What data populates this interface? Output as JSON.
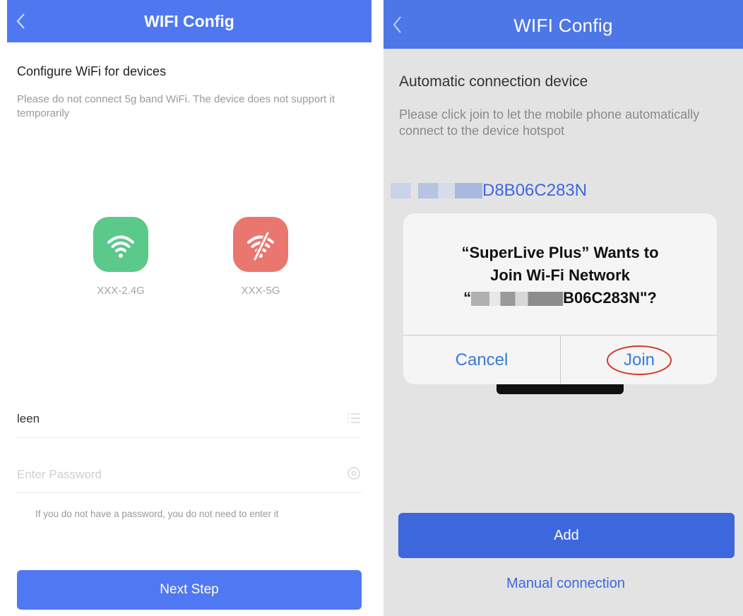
{
  "left": {
    "nav_title": "WIFI Config",
    "heading": "Configure WiFi for devices",
    "notice": "Please do not connect 5g band WiFi. The device does not support it temporarily",
    "wifi_options": [
      {
        "label": "XXX-2.4G",
        "color": "#5ac98a",
        "icon": "wifi-icon"
      },
      {
        "label": "XXX-5G",
        "color": "#ea7670",
        "icon": "wifi-off-icon"
      }
    ],
    "ssid_value": "leen",
    "password_placeholder": "Enter Password",
    "password_hint": "If you do not have a password, you do not need to enter it",
    "next_button": "Next Step",
    "accent": "#5078f2"
  },
  "right": {
    "nav_title": "WIFI Config",
    "heading": "Automatic connection device",
    "instructions": "Please click join to let the mobile phone automatically connect to the device hotspot",
    "device_ssid_visible": "D8B06C283N",
    "dialog": {
      "title_line1": "“SuperLive Plus” Wants to",
      "title_line2": "Join Wi-Fi Network",
      "title_line3_visible": "B06C283N\"?",
      "cancel": "Cancel",
      "join": "Join"
    },
    "add_button": "Add",
    "manual_link": "Manual connection",
    "accent": "#3d67dd",
    "link_color": "#3d67dd"
  }
}
